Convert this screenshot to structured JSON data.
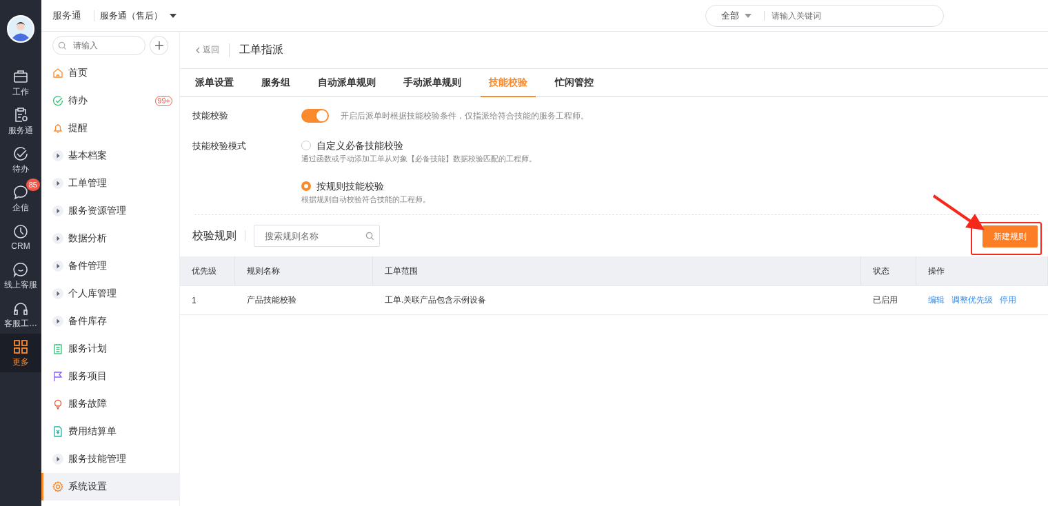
{
  "rail": {
    "items": [
      {
        "label": "工作",
        "kind": "work",
        "selected": false
      },
      {
        "label": "服务通",
        "kind": "service",
        "selected": false
      },
      {
        "label": "待办",
        "kind": "todo",
        "selected": false
      },
      {
        "label": "企信",
        "kind": "chat",
        "selected": false,
        "badge": "85"
      },
      {
        "label": "CRM",
        "kind": "clock",
        "selected": false
      },
      {
        "label": "线上客服",
        "kind": "online",
        "selected": false
      },
      {
        "label": "客服工…",
        "kind": "headset",
        "selected": false
      },
      {
        "label": "更多",
        "kind": "grid",
        "selected": true
      }
    ]
  },
  "top_bar": {
    "app_title": "服务通",
    "app_switch": "服务通（售后）",
    "search": {
      "scope": "全部",
      "placeholder": "请输入关键词"
    }
  },
  "sidebar": {
    "search_placeholder": "请输入",
    "items": [
      {
        "label": "首页",
        "kind": "home",
        "selected": false
      },
      {
        "label": "待办",
        "kind": "todo",
        "selected": false,
        "badge": "99+"
      },
      {
        "label": "提醒",
        "kind": "bell",
        "selected": false
      },
      {
        "label": "基本档案",
        "kind": "group",
        "selected": false
      },
      {
        "label": "工单管理",
        "kind": "group",
        "selected": false
      },
      {
        "label": "服务资源管理",
        "kind": "group",
        "selected": false
      },
      {
        "label": "数据分析",
        "kind": "group",
        "selected": false
      },
      {
        "label": "备件管理",
        "kind": "group",
        "selected": false
      },
      {
        "label": "个人库管理",
        "kind": "group",
        "selected": false
      },
      {
        "label": "备件库存",
        "kind": "group",
        "selected": false
      },
      {
        "label": "服务计划",
        "kind": "plan",
        "selected": false
      },
      {
        "label": "服务项目",
        "kind": "flag",
        "selected": false
      },
      {
        "label": "服务故障",
        "kind": "bulb",
        "selected": false
      },
      {
        "label": "费用结算单",
        "kind": "bill",
        "selected": false
      },
      {
        "label": "服务技能管理",
        "kind": "group",
        "selected": false
      },
      {
        "label": "系统设置",
        "kind": "gear",
        "selected": true
      }
    ]
  },
  "page": {
    "back": "返回",
    "title": "工单指派"
  },
  "tabs": [
    {
      "label": "派单设置",
      "selected": false
    },
    {
      "label": "服务组",
      "selected": false
    },
    {
      "label": "自动派单规则",
      "selected": false
    },
    {
      "label": "手动派单规则",
      "selected": false
    },
    {
      "label": "技能校验",
      "selected": true
    },
    {
      "label": "忙闲管控",
      "selected": false
    }
  ],
  "skill_check": {
    "label": "技能校验",
    "on": true,
    "hint": "开启后派单时根据技能校验条件，仅指派给符合技能的服务工程师。"
  },
  "mode": {
    "label": "技能校验模式",
    "options": [
      {
        "label": "自定义必备技能校验",
        "description": "通过函数或手动添加工单从对象【必备技能】数据校验匹配的工程师。",
        "selected": false
      },
      {
        "label": "按规则技能校验",
        "description": "根据规则自动校验符合技能的工程师。",
        "selected": true
      }
    ]
  },
  "rules": {
    "title": "校验规则",
    "search_placeholder": "搜索规则名称",
    "new_button": "新建规则",
    "columns": [
      "优先级",
      "规则名称",
      "工单范围",
      "状态",
      "操作"
    ],
    "rows": [
      {
        "cells": [
          "1",
          "产品技能校验",
          "工单.关联产品包含示例设备",
          "已启用"
        ],
        "actions": [
          "编辑",
          "调整优先级",
          "停用"
        ]
      }
    ]
  }
}
